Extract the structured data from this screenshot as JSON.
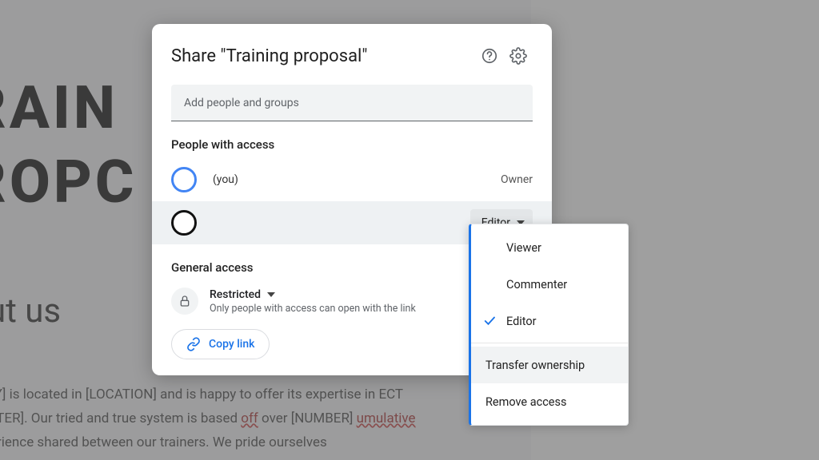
{
  "background": {
    "title_line1": "RAIN",
    "title_line2": "ROPC",
    "subhead": "out us",
    "para": "PANY] is located in [LOCATION] and is happy to offer its expertise in ECT MATTER]. Our tried and true system is based <u>off</u> over [NUMBER] <u>umulative</u> experience shared between our trainers. We pride ourselves"
  },
  "dialog": {
    "title": "Share \"Training proposal\"",
    "add_placeholder": "Add people and groups",
    "people_h": "People with access",
    "people": [
      {
        "name": "(you)",
        "role": "Owner",
        "avatar_color": "blue"
      },
      {
        "name": "",
        "role": "Editor",
        "avatar_color": "black"
      }
    ],
    "general_h": "General access",
    "access_label": "Restricted",
    "access_desc": "Only people with access can open with the link",
    "copy_link": "Copy link"
  },
  "dropdown": {
    "items": [
      {
        "label": "Viewer",
        "selected": false
      },
      {
        "label": "Commenter",
        "selected": false
      },
      {
        "label": "Editor",
        "selected": true
      }
    ],
    "extras": [
      {
        "label": "Transfer ownership",
        "hover": true
      },
      {
        "label": "Remove access",
        "hover": false
      }
    ]
  }
}
